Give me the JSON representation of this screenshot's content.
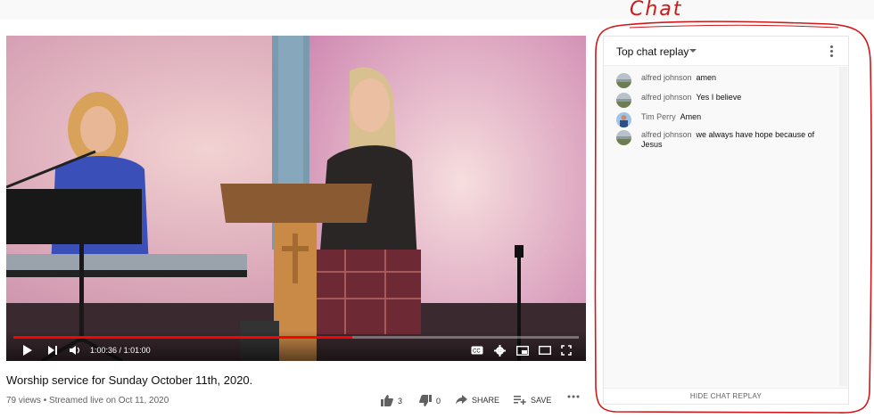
{
  "annotation": {
    "text": "Chat",
    "color": "#d01818"
  },
  "video": {
    "progress_fraction": 0.6,
    "current_time": "1:00:36",
    "separator": "/",
    "duration": "1:01:00",
    "title": "Worship service for Sunday October 11th, 2020.",
    "views": "79 views",
    "streamed": "Streamed live on Oct 11, 2020"
  },
  "actions": {
    "like_count": "3",
    "dislike_count": "0",
    "share_label": "SHARE",
    "save_label": "SAVE"
  },
  "chat": {
    "title": "Top chat replay",
    "hide_label": "HIDE CHAT REPLAY",
    "messages": [
      {
        "author": "alfred johnson",
        "text": "amen"
      },
      {
        "author": "alfred johnson",
        "text": "Yes I believe"
      },
      {
        "author": "Tim Perry",
        "text": "Amen"
      },
      {
        "author": "alfred johnson",
        "text": "we always have hope because of Jesus"
      }
    ]
  },
  "colors": {
    "accent": "#ff0000",
    "annotation": "#d01818"
  }
}
